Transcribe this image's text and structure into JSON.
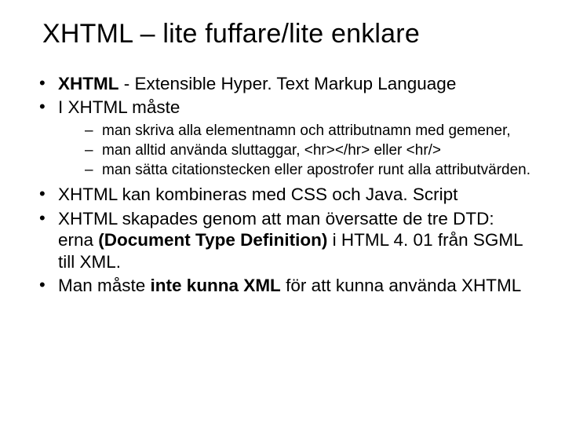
{
  "title": "XHTML – lite fuffare/lite enklare",
  "bullets": {
    "b1_pre": "XHTML",
    "b1_post": " - Extensible Hyper. Text Markup Language",
    "b2": "I  XHTML måste",
    "sub1_a": "man skriva alla elementnamn och attributnamn med ",
    "sub1_b": "gemener",
    "sub1_c": ",",
    "sub2_a": "man alltid använda ",
    "sub2_b": "sluttaggar",
    "sub2_c": ", <hr></hr> eller <hr/>",
    "sub3_a": "man sätta ",
    "sub3_b": "citationstecken",
    "sub3_c": " eller apostrofer runt alla attributvärden.",
    "b3_a": "XHTML kan ",
    "b3_b": "kombineras",
    "b3_c": " med CSS och  Java. Script",
    "b4_a": "XHTML skapades genom att man översatte de tre DTD: erna  ",
    "b4_b": "(Document Type Definition)",
    "b4_c": " i HTML 4. 01 från SGML till ",
    "b4_d": "XML",
    "b4_e": ".",
    "b5_a": "Man måste ",
    "b5_b": "inte kunna XML",
    "b5_c": " för att kunna använda XHTML"
  }
}
